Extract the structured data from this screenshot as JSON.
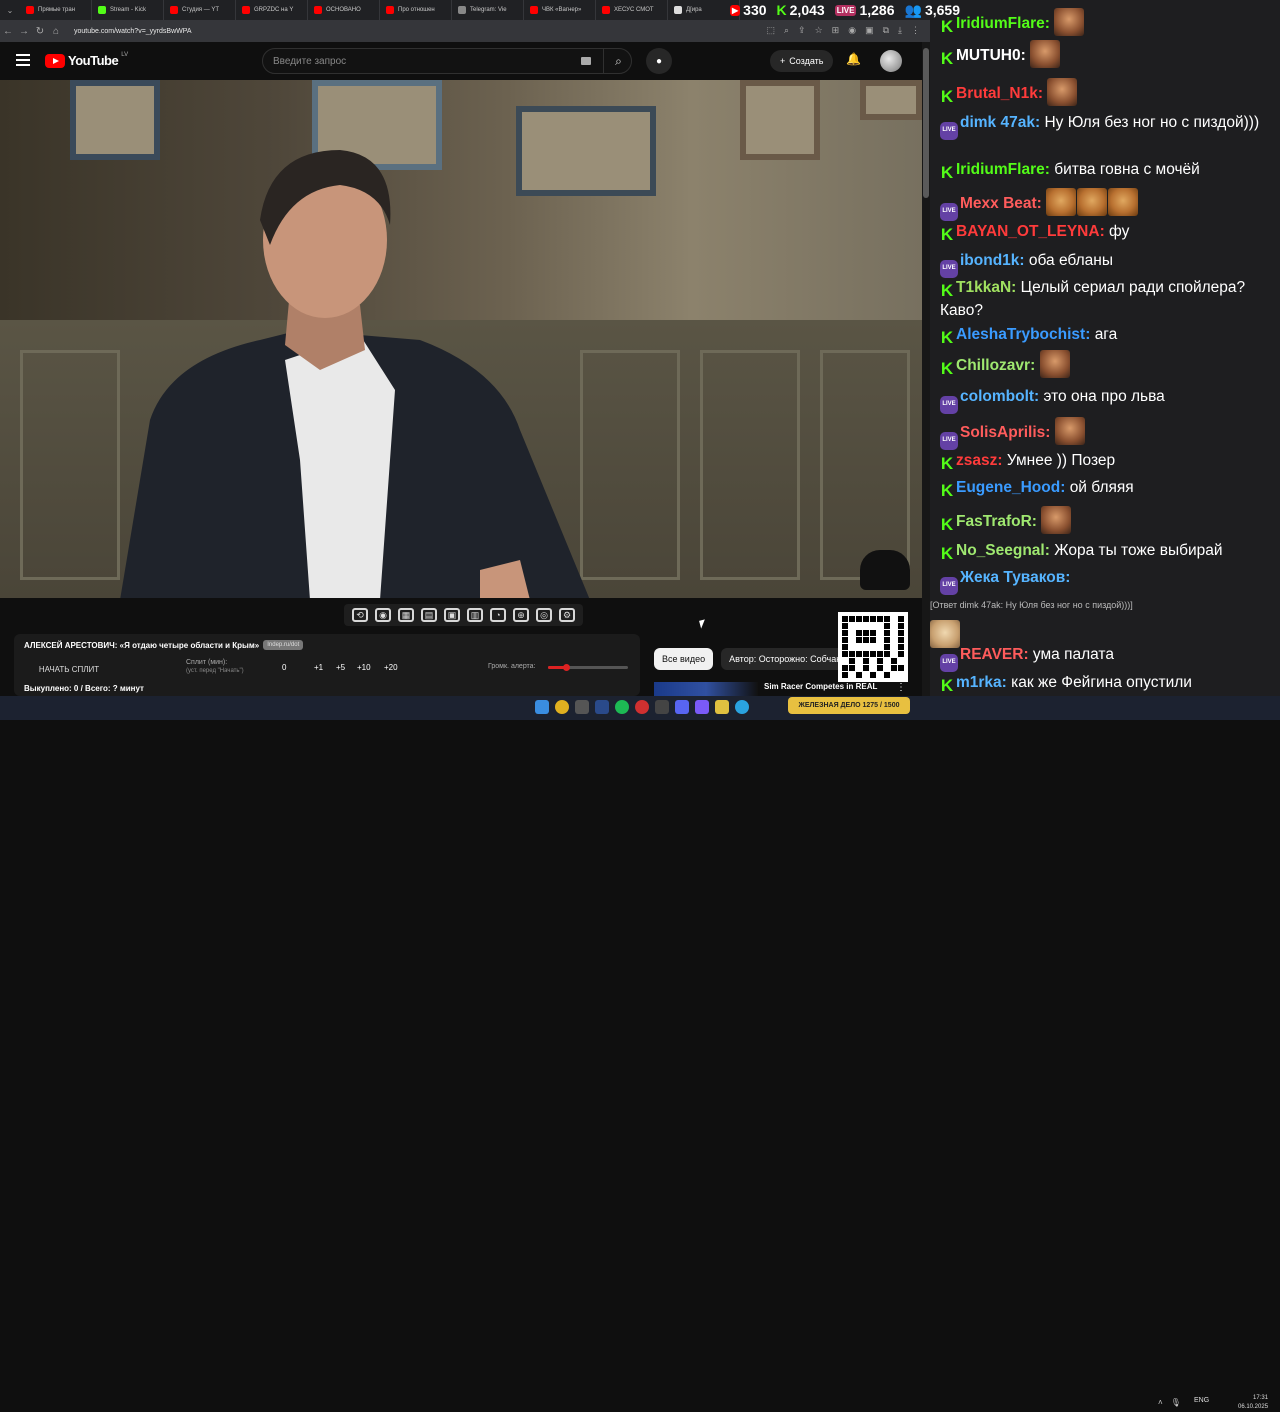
{
  "browser": {
    "tabs": [
      {
        "label": "Прямые тран",
        "color": "#ff0000"
      },
      {
        "label": "Stream - Kick",
        "color": "#53fc18"
      },
      {
        "label": "Студия — YT",
        "color": "#ff0000"
      },
      {
        "label": "GRPZDC на Y",
        "color": "#ff0000"
      },
      {
        "label": "ОСНОВАНО",
        "color": "#ff0000"
      },
      {
        "label": "Про отношен",
        "color": "#ff0000"
      },
      {
        "label": "Telegram: Vie",
        "color": "#888888"
      },
      {
        "label": "ЧВК «Вагнер»",
        "color": "#ff0000"
      },
      {
        "label": "ХЕСУС СМОТ",
        "color": "#ff0000"
      },
      {
        "label": "Д[ира",
        "color": "#dddddd"
      }
    ],
    "url": "youtube.com/watch?v=_yyrdsBwWPA"
  },
  "stats": {
    "youtube_viewers": "330",
    "kick_viewers": "2,043",
    "live_viewers": "1,286",
    "total_viewers": "3,659",
    "live_badge": "LIVE"
  },
  "youtube": {
    "logo_text": "YouTube",
    "country_code": "LV",
    "search_placeholder": "Введите запрос",
    "create_label": "Создать",
    "create_icon": "+",
    "search_icon": "⌕",
    "mic_icon": "●",
    "bell_icon": "🔔"
  },
  "overlay": {
    "video_title": "АЛЕКСЕЙ АРЕСТОВИЧ: «Я отдаю четыре области и Крым»",
    "tag": "Indep.ru/dot",
    "split_button": "НАЧАТЬ СПЛИТ",
    "split_label": "Сплит (мин):",
    "split_hint": "(уст. перед \"Начать\")",
    "split_value": "0",
    "increments": [
      "+1",
      "+5",
      "+10",
      "+20"
    ],
    "volume_label": "Громк. алерта:",
    "volume_level": 0.22,
    "bought": "Выкуплено: 0 / Всего: ? минут"
  },
  "player": {
    "controls": [
      "⟲",
      "◉",
      "▦",
      "▤",
      "▣",
      "▥",
      "◔",
      "⊕",
      "◎",
      "⚙"
    ]
  },
  "below": {
    "chip_all": "Все видео",
    "chip_author": "Автор: Осторожно: Собчак",
    "reco_title": "Sim Racer Competes in REAL",
    "more": "⋮"
  },
  "chat": [
    {
      "platform": "kick",
      "user": "IridiumFlare:",
      "color": "#53fc18",
      "text": "",
      "emote": "face"
    },
    {
      "platform": "kick",
      "user": "MUTUH0:",
      "color": "#ffffff",
      "text": "",
      "emote": "face"
    },
    {
      "platform": "kick",
      "user": "Brutal_N1k:",
      "color": "#ff3b3b",
      "text": "",
      "emote": "face"
    },
    {
      "platform": "live",
      "user": "dimk 47ak:",
      "color": "#56b4ff",
      "text": "Ну Юля без ног но с пиздой)))",
      "emote": ""
    },
    {
      "platform": "kick",
      "user": "IridiumFlare:",
      "color": "#53fc18",
      "text": "битва говна с мочёй",
      "emote": ""
    },
    {
      "platform": "live",
      "user": "Mexx Beat:",
      "color": "#ff5c5c",
      "text": "",
      "emote": "dogs"
    },
    {
      "platform": "kick",
      "user": "BAYAN_OT_LEYNA:",
      "color": "#ff3b3b",
      "text": "фу",
      "emote": ""
    },
    {
      "platform": "live",
      "user": "ibond1k:",
      "color": "#56b4ff",
      "text": "оба ебланы",
      "emote": ""
    },
    {
      "platform": "kick",
      "user": "T1kkaN:",
      "color": "#a0e060",
      "text": "Целый сериал ради спойлера? Каво?",
      "emote": ""
    },
    {
      "platform": "kick",
      "user": "AleshaTrybochist:",
      "color": "#3a9bff",
      "text": "ага",
      "emote": ""
    },
    {
      "platform": "kick",
      "user": "Chillozavr:",
      "color": "#9fe870",
      "text": "",
      "emote": "face"
    },
    {
      "platform": "live",
      "user": "colombolt:",
      "color": "#56b4ff",
      "text": "это она про льва",
      "emote": ""
    },
    {
      "platform": "live",
      "user": "SolisAprilis:",
      "color": "#ff5c5c",
      "text": "",
      "emote": "face"
    },
    {
      "platform": "kick",
      "user": "zsasz:",
      "color": "#ff3b3b",
      "text": "Умнее )) Позер",
      "emote": ""
    },
    {
      "platform": "kick",
      "user": "Eugene_Hood:",
      "color": "#3a9bff",
      "text": "ой бляяя",
      "emote": ""
    },
    {
      "platform": "kick",
      "user": "FasTrafoR:",
      "color": "#9fe870",
      "text": "",
      "emote": "face"
    },
    {
      "platform": "kick",
      "user": "No_Seegnal:",
      "color": "#9fe870",
      "text": "Жора ты тоже выбирай",
      "emote": ""
    },
    {
      "platform": "live",
      "user": "Жека Туваков:",
      "color": "#56b4ff",
      "text": "",
      "emote": "",
      "reply": "[Ответ dimk 47ak: Ну Юля без ног но с пиздой)))]"
    },
    {
      "platform": "live",
      "user": "REAVER:",
      "color": "#ff5c5c",
      "text": "ума палата",
      "emote": ""
    },
    {
      "platform": "kick",
      "user": "m1rka:",
      "color": "#56b4ff",
      "text": "как же Фейгина опустили",
      "emote": ""
    }
  ],
  "taskbar": {
    "kick_note": "ЖЕЛЕЗНАЯ ДЕЛО 1275 / 1500",
    "lang": "ENG",
    "time": "17:31",
    "date": "06.10.2025"
  }
}
